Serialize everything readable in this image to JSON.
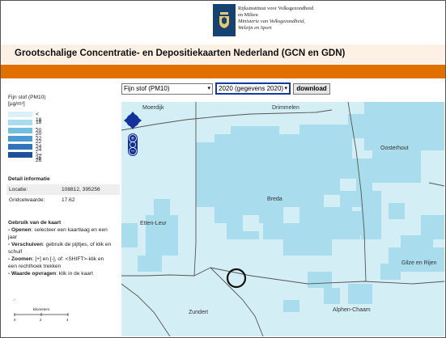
{
  "header": {
    "org_line1": "Rijksinstituut voor Volksgezondheid",
    "org_line2": "en Milieu",
    "ministry_line1": "Ministerie van Volksgezondheid,",
    "ministry_line2": "Welzijn en Sport",
    "title": "Grootschalige Concentratie- en Depositiekaarten Nederland (GCN en GDN)"
  },
  "controls": {
    "component_selected": "Fijn stof (PM10)",
    "year_selected": "2020 (gegevens 2020)",
    "download_label": "download"
  },
  "legend": {
    "title_line1": "Fijn stof (PM10)",
    "title_line2": "[µg/m³]",
    "classes": [
      {
        "label": "< 18",
        "color": "#d9f1f8"
      },
      {
        "label": "18 - 20",
        "color": "#a9dcec"
      },
      {
        "label": "20 - 22",
        "color": "#72bfe0"
      },
      {
        "label": "22 - 24",
        "color": "#4a9bd2"
      },
      {
        "label": "24 - 26",
        "color": "#2f74bb"
      },
      {
        "label": ">= 26",
        "color": "#1d4f9a"
      }
    ]
  },
  "detail": {
    "heading": "Detail informatie",
    "location_label": "Locatie:",
    "location_value": "108812, 395256",
    "grid_label": "Gridcelwaarde:",
    "grid_value": "17.62"
  },
  "usage": {
    "heading": "Gebruik van de kaart",
    "items": [
      {
        "bold": "Openen",
        "text": ": selecteer een kaartlaag en een jaar"
      },
      {
        "bold": "Verschuiven",
        "text": ": gebruik de pijltjes, of klik en schuif"
      },
      {
        "bold": "Zoomen",
        "text": ": [+] en [-], of: <SHIFT>-klik en een rechthoek trekken"
      },
      {
        "bold": "Waarde opvragen",
        "text": ": klik in de kaart"
      }
    ]
  },
  "scale": {
    "label": "kilometers",
    "ticks": [
      "0",
      "2",
      "4"
    ]
  },
  "map": {
    "towns": [
      "Moerdijk",
      "Drimmelen",
      "Oosterhout",
      "Breda",
      "Etten-Leur",
      "Gilze en Rijen",
      "Zundert",
      "Alphen-Chaam"
    ],
    "background_color": "#d4eef6",
    "cell_color": "#a9dcec"
  }
}
